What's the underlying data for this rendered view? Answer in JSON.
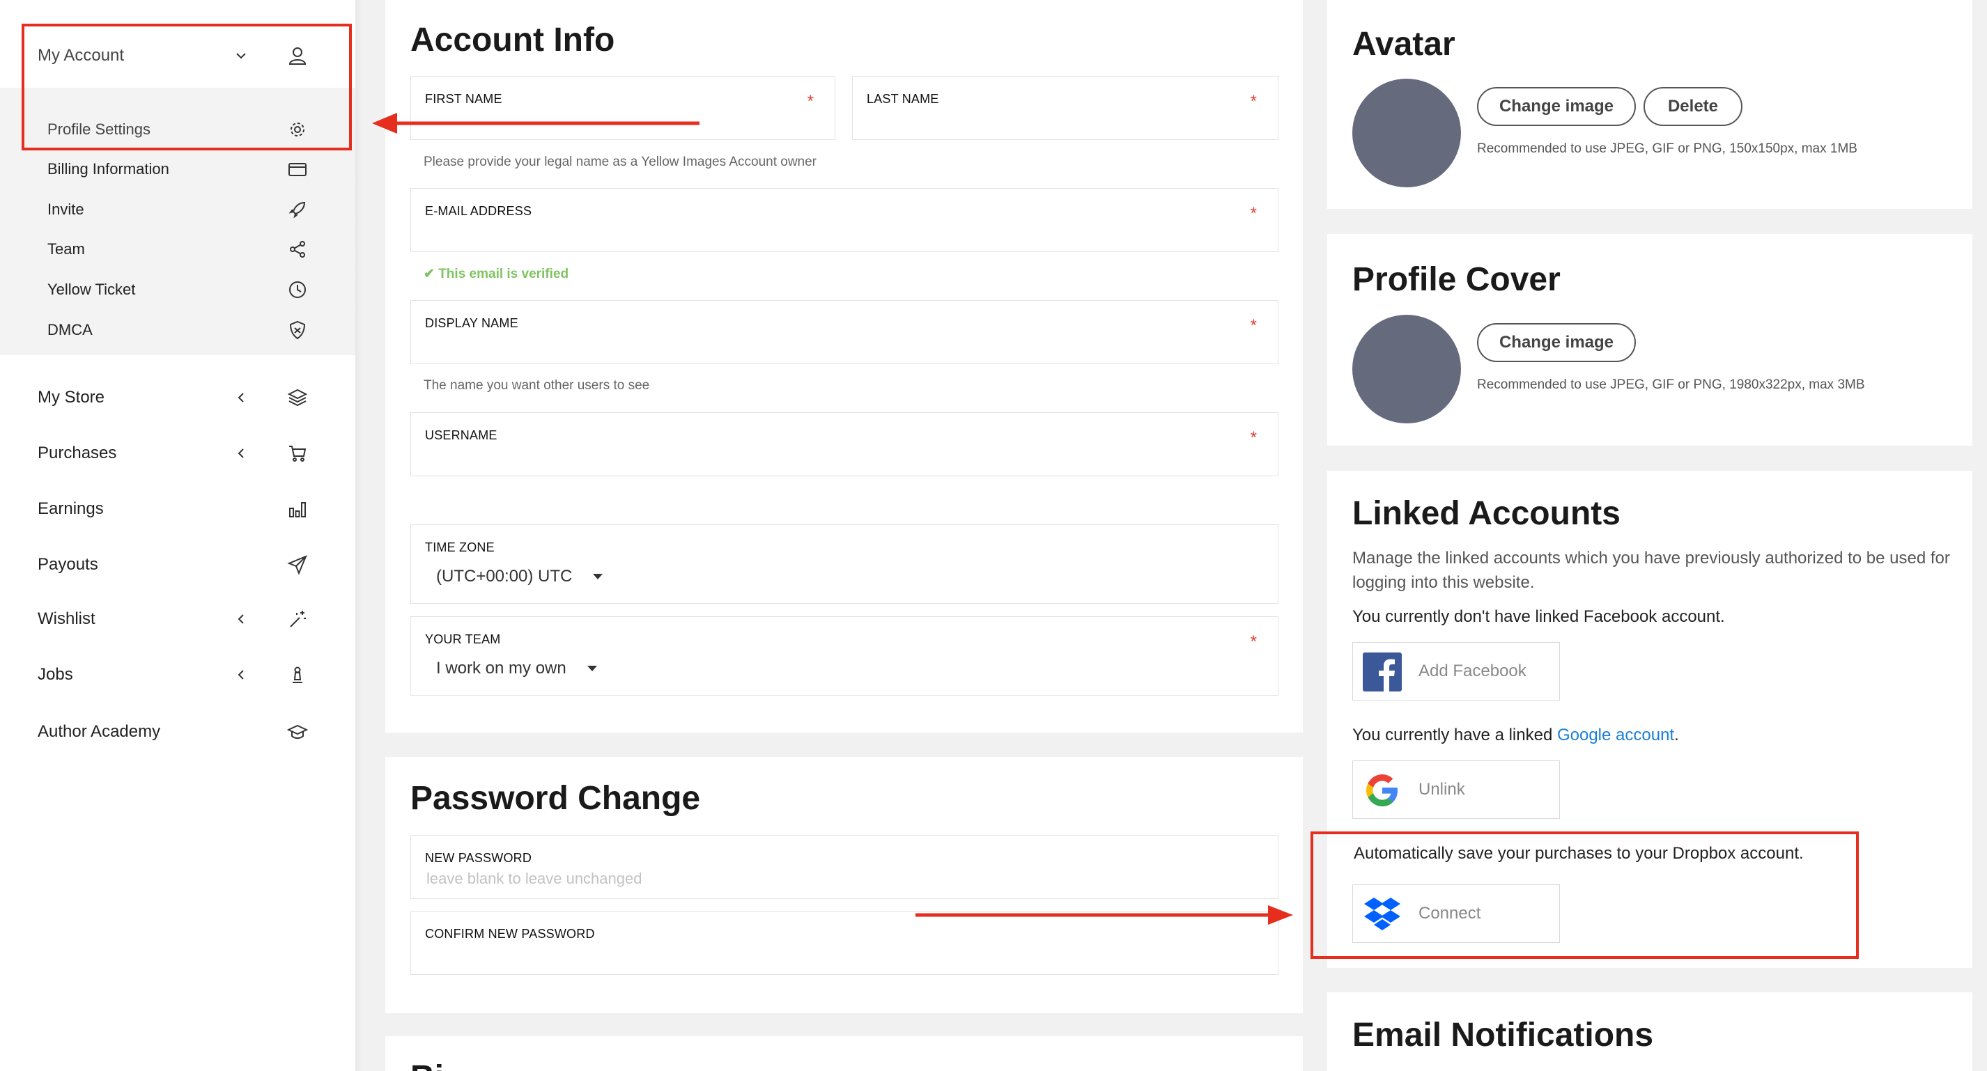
{
  "sidebar": {
    "account": {
      "label": "My Account",
      "icon": "user-icon"
    },
    "sub_items": [
      {
        "label": "Profile Settings",
        "icon": "gear-icon"
      },
      {
        "label": "Billing Information",
        "icon": "card-icon"
      },
      {
        "label": "Invite",
        "icon": "rocket-icon"
      },
      {
        "label": "Team",
        "icon": "share-icon"
      },
      {
        "label": "Yellow Ticket",
        "icon": "clock-icon"
      },
      {
        "label": "DMCA",
        "icon": "shield-icon"
      }
    ],
    "items": [
      {
        "label": "My Store",
        "icon": "layers-icon"
      },
      {
        "label": "Purchases",
        "icon": "cart-icon"
      },
      {
        "label": "Earnings",
        "icon": "bar-chart-icon"
      },
      {
        "label": "Payouts",
        "icon": "paper-plane-icon"
      },
      {
        "label": "Wishlist",
        "icon": "magic-wand-icon"
      },
      {
        "label": "Jobs",
        "icon": "chess-pawn-icon"
      },
      {
        "label": "Author Academy",
        "icon": "graduation-cap-icon"
      }
    ]
  },
  "account_info": {
    "title": "Account Info",
    "first_name_label": "FIRST NAME",
    "last_name_label": "LAST NAME",
    "name_hint": "Please provide your legal name as a Yellow Images Account owner",
    "email_label": "E-MAIL ADDRESS",
    "email_verified": "This email is verified",
    "display_name_label": "DISPLAY NAME",
    "display_name_hint": "The name you want other users to see",
    "username_label": "USERNAME",
    "timezone_label": "TIME ZONE",
    "timezone_value": "(UTC+00:00) UTC",
    "team_label": "YOUR TEAM",
    "team_value": "I work on my own",
    "required_mark": "*"
  },
  "password": {
    "title": "Password Change",
    "new_label": "NEW PASSWORD",
    "new_placeholder": "leave blank to leave unchanged",
    "confirm_label": "CONFIRM NEW PASSWORD"
  },
  "bio_title_partial": "Bi",
  "avatar": {
    "title": "Avatar",
    "change_label": "Change image",
    "delete_label": "Delete",
    "recommendation": "Recommended to use JPEG, GIF or PNG, 150x150px, max 1MB"
  },
  "cover": {
    "title": "Profile Cover",
    "change_label": "Change image",
    "recommendation": "Recommended to use JPEG, GIF or PNG, 1980x322px, max 3MB"
  },
  "linked": {
    "title": "Linked Accounts",
    "description": "Manage the linked accounts which you have previously authorized to be used for logging into this website.",
    "facebook_status": "You currently don't have linked Facebook account.",
    "facebook_button": "Add Facebook",
    "google_status_prefix": "You currently have a linked ",
    "google_link": "Google account",
    "google_status_suffix": ".",
    "google_button": "Unlink",
    "dropbox_text": "Automatically save your purchases to your Dropbox account.",
    "dropbox_button": "Connect"
  },
  "email_notifications": {
    "title": "Email Notifications"
  },
  "colors": {
    "annotation_red": "#e62e1f",
    "required_red": "#e53b2f",
    "verified_green": "#7fc461",
    "link_blue": "#1a7fd6",
    "avatar_gray": "#656a7d",
    "facebook_blue": "#3b5998",
    "dropbox_blue": "#0061fe"
  }
}
